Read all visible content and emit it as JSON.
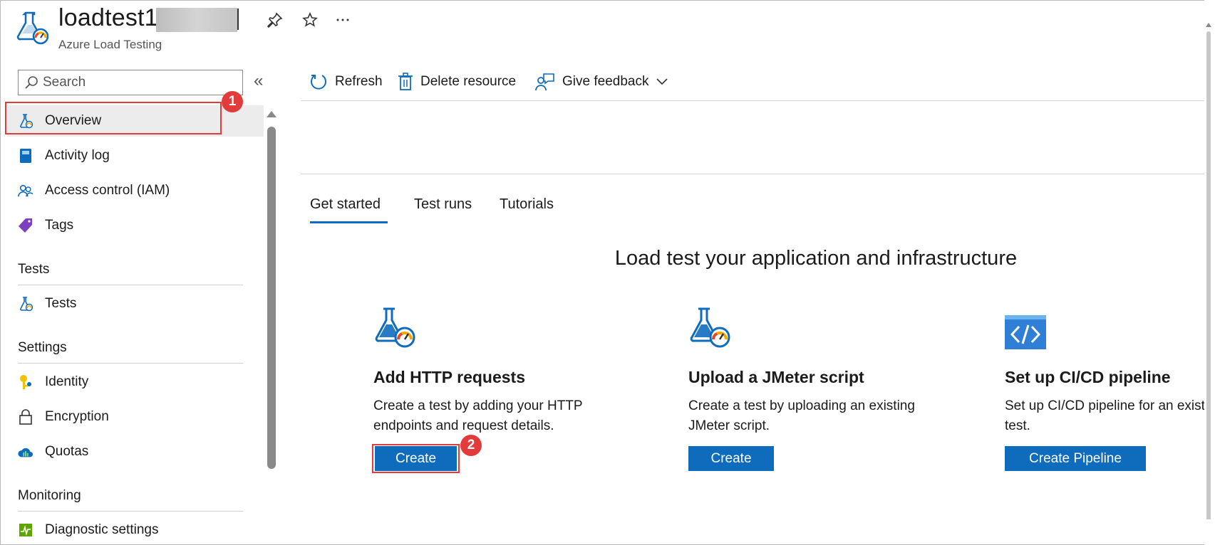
{
  "header": {
    "title": "loadtest1",
    "subtitle": "Azure Load Testing",
    "logo_icon": "load-testing-flask-icon",
    "actions": [
      "pin-icon",
      "star-icon",
      "more-icon"
    ]
  },
  "sidebar": {
    "search_placeholder": "Search",
    "items": [
      {
        "label": "Overview",
        "icon": "load-testing-flask-icon",
        "selected": true
      },
      {
        "label": "Activity log",
        "icon": "activity-log-icon"
      },
      {
        "label": "Access control (IAM)",
        "icon": "people-icon"
      },
      {
        "label": "Tags",
        "icon": "tag-icon"
      }
    ],
    "sections": [
      {
        "title": "Tests",
        "items": [
          {
            "label": "Tests",
            "icon": "load-testing-flask-icon"
          }
        ]
      },
      {
        "title": "Settings",
        "items": [
          {
            "label": "Identity",
            "icon": "identity-key-icon"
          },
          {
            "label": "Encryption",
            "icon": "lock-icon"
          },
          {
            "label": "Quotas",
            "icon": "cloud-quota-icon"
          }
        ]
      },
      {
        "title": "Monitoring",
        "items": [
          {
            "label": "Diagnostic settings",
            "icon": "diagnostic-icon"
          }
        ]
      }
    ]
  },
  "toolbar": {
    "refresh": "Refresh",
    "delete": "Delete resource",
    "feedback": "Give feedback"
  },
  "tabs": [
    {
      "label": "Get started",
      "active": true
    },
    {
      "label": "Test runs"
    },
    {
      "label": "Tutorials"
    }
  ],
  "main": {
    "heading": "Load test your application and infrastructure",
    "cards": [
      {
        "title": "Add HTTP requests",
        "desc_line1": "Create a test by adding your HTTP",
        "desc_line2": "endpoints and request details.",
        "button": "Create",
        "icon": "load-testing-flask-icon"
      },
      {
        "title": "Upload a JMeter script",
        "desc_line1": "Create a test by uploading an existing",
        "desc_line2": "JMeter script.",
        "button": "Create",
        "icon": "load-testing-flask-icon"
      },
      {
        "title": "Set up CI/CD pipeline",
        "desc_line1": "Set up CI/CD pipeline for an exist",
        "desc_line2": "test.",
        "button": "Create Pipeline",
        "icon": "code-brackets-icon"
      }
    ]
  },
  "annotations": {
    "badge1": "1",
    "badge2": "2"
  },
  "colors": {
    "accent": "#0f6cbd",
    "highlight": "#e23b3b"
  }
}
